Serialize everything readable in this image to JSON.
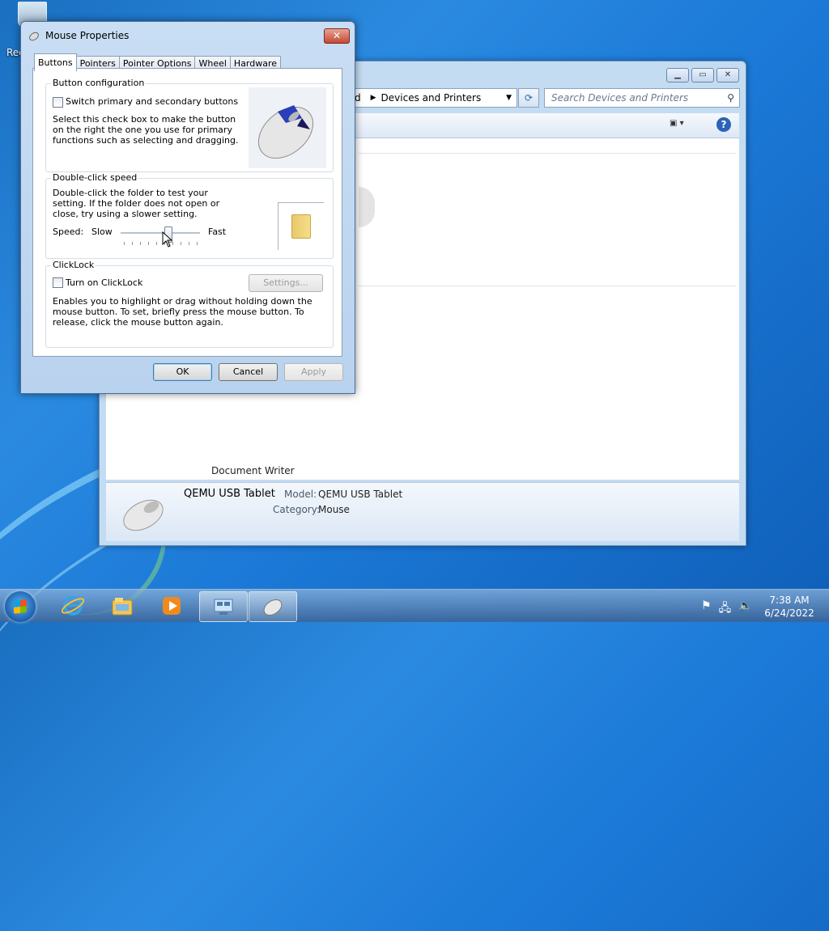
{
  "desktop": {
    "recycle_label": "Rec"
  },
  "explorer": {
    "breadcrumb_prefix": "d",
    "breadcrumb": "Devices and Printers",
    "search_placeholder": "Search Devices and Printers",
    "document_writer": "Document Writer",
    "details": {
      "name": "QEMU USB Tablet",
      "model_label": "Model:",
      "model_value": "QEMU USB Tablet",
      "category_label": "Category:",
      "category_value": "Mouse"
    }
  },
  "dialog": {
    "title": "Mouse Properties",
    "tabs": [
      "Buttons",
      "Pointers",
      "Pointer Options",
      "Wheel",
      "Hardware"
    ],
    "active_tab": "Buttons",
    "button_config": {
      "label": "Button configuration",
      "checkbox_label": "Switch primary and secondary buttons",
      "checked": false,
      "description": "Select this check box to make the button on the right the one you use for primary functions such as selecting and dragging."
    },
    "double_click": {
      "label": "Double-click speed",
      "description": "Double-click the folder to test your setting. If the folder does not open or close, try using a slower setting.",
      "speed_label": "Speed:",
      "slow": "Slow",
      "fast": "Fast",
      "slider_value": 0.6
    },
    "clicklock": {
      "label": "ClickLock",
      "checkbox_label": "Turn on ClickLock",
      "checked": false,
      "settings_button": "Settings...",
      "description": "Enables you to highlight or drag without holding down the mouse button. To set, briefly press the mouse button. To release, click the mouse button again."
    },
    "buttons": {
      "ok": "OK",
      "cancel": "Cancel",
      "apply": "Apply"
    }
  },
  "taskbar": {
    "time": "7:38 AM",
    "date": "6/24/2022",
    "pinned": [
      "start-orb",
      "internet-explorer-icon",
      "windows-explorer-icon",
      "media-player-icon",
      "devices-and-printers-icon",
      "mouse-icon"
    ]
  },
  "colors": {
    "accent": "#1b5fae",
    "close": "#c54a34"
  }
}
